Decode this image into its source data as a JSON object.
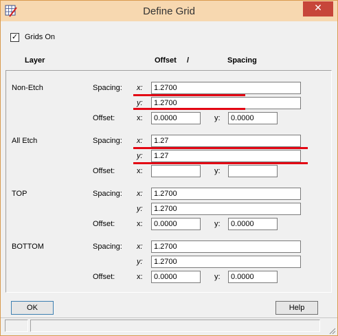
{
  "window": {
    "title": "Define Grid",
    "close_glyph": "✕"
  },
  "grids_on": {
    "label": "Grids On",
    "checked": true,
    "check_glyph": "✓"
  },
  "headers": {
    "layer": "Layer",
    "offset": "Offset",
    "slash": "/",
    "spacing": "Spacing"
  },
  "labels": {
    "spacing": "Spacing:",
    "offset": "Offset:",
    "x": "x:",
    "y": "y:"
  },
  "layers": [
    {
      "name": "Non-Etch",
      "spacing_x": "1.2700",
      "spacing_y": "1.2700",
      "offset_x": "0.0000",
      "offset_y": "0.0000"
    },
    {
      "name": "All Etch",
      "spacing_x": "1.27",
      "spacing_y": "1.27",
      "offset_x": "",
      "offset_y": ""
    },
    {
      "name": "TOP",
      "spacing_x": "1.2700",
      "spacing_y": "1.2700",
      "offset_x": "0.0000",
      "offset_y": "0.0000"
    },
    {
      "name": "BOTTOM",
      "spacing_x": "1.2700",
      "spacing_y": "1.2700",
      "offset_x": "0.0000",
      "offset_y": "0.0000"
    }
  ],
  "buttons": {
    "ok": "OK",
    "help": "Help"
  },
  "colors": {
    "titlebar": "#f7d8b0",
    "close": "#c7463a",
    "annotation": "#e30613"
  },
  "icons": {
    "app": "grid-app-icon",
    "close": "close-icon",
    "check": "checkmark-icon"
  }
}
